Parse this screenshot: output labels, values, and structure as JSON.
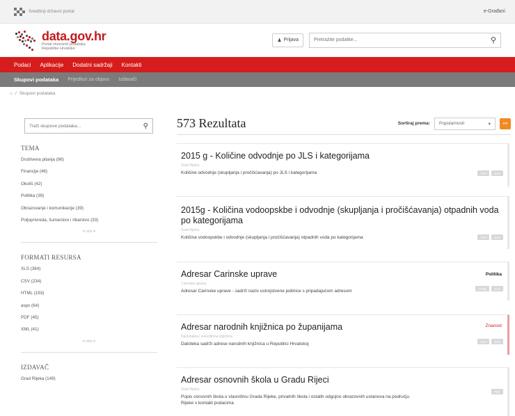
{
  "topbar": {
    "portal": "Središnji državni portal",
    "egradani": "e-Građani"
  },
  "header": {
    "logo_title": "data.gov.hr",
    "logo_sub1": "Portal otvorenih podataka",
    "logo_sub2": "Republike Hrvatske",
    "login_label": "Prijava",
    "search_placeholder": "Pretražite podatke..."
  },
  "nav": [
    "Podaci",
    "Aplikacije",
    "Dodatni sadržaji",
    "Kontakti"
  ],
  "subnav": [
    "Skupovi podataka",
    "Prijedlozi za objavu",
    "Izdavači"
  ],
  "breadcrumb": {
    "item": "Skupovi podataka"
  },
  "sidebar": {
    "search_placeholder": "Traži skupove podataka...",
    "facets": [
      {
        "title": "TEMA",
        "items": [
          "Društvena pitanja (96)",
          "Financije (46)",
          "Okoliš (42)",
          "Politika (39)",
          "Obrazovanje i komunikacije (39)",
          "Poljoprivreda, šumarstvo i ribarstvo (33)"
        ],
        "more": "▾ više ▾"
      },
      {
        "title": "FORMATI RESURSA",
        "items": [
          "XLS (384)",
          "CSV (234)",
          "HTML (193)",
          "aspx (64)",
          "PDF (45)",
          "XML (41)"
        ],
        "more": "▾ više ▾"
      },
      {
        "title": "IZDAVAČ",
        "items": [
          "Grad Rijeka (149)"
        ],
        "more": ""
      }
    ]
  },
  "results": {
    "count": "573 Rezultata",
    "sort_label": "Sortiraj prema:",
    "sort_value": "Popularnosti",
    "items": [
      {
        "title": "2015 g - Količine odvodnje po JLS i kategorijama",
        "org": "Grad Rijeka",
        "desc": "Količine odvodnje (skupljanja i pročišćavanja) po JLS i kategorijama",
        "tag": "",
        "formats": [
          "CSV",
          "XLS"
        ]
      },
      {
        "title": "2015g - Količina vodoopskbe i odvodnje (skupljanja i pročišćavanja) otpadnih voda po kategorijama",
        "org": "Grad Rijeka",
        "desc": "Količina vodoopskbe i odvodnje (skupljanja i pročišćavanja) otpadnih voda po kategorijama",
        "tag": "",
        "formats": [
          "CSV",
          "XLS"
        ]
      },
      {
        "title": "Adresar Carinske uprave",
        "org": "Carinska uprava",
        "desc": "Adresar Carinske uprave - sadrži naziv ustrojstvene jedinice s pripadajućom adresom",
        "tag": "Politika",
        "formats": [
          "HTML",
          "XLS"
        ]
      },
      {
        "title": "Adresar narodnih knjižnica po županijama",
        "org": "Nacionalna i sveučilišna knjižnica",
        "desc": "Datoteka sadrži adrese narodnih knjižnica u Republici Hrvatskoj",
        "tag": "Znanost",
        "formats": [
          "CSV",
          "XLS"
        ]
      },
      {
        "title": "Adresar osnovnih škola u Gradu Rijeci",
        "org": "Grad Rijeka",
        "desc": "Popis osnovnih škola u vlasništvu Grada Rijeke, privatnih škola i ostalih odgojno obrazovnih ustanova na području Rijeke s kontakt podacima",
        "tag": "",
        "formats": [
          "PDF"
        ]
      }
    ]
  },
  "colors": {
    "brand_red": "#d61c1c",
    "subnav_grey": "#7b7b7b",
    "rss_orange": "#f08a24"
  }
}
